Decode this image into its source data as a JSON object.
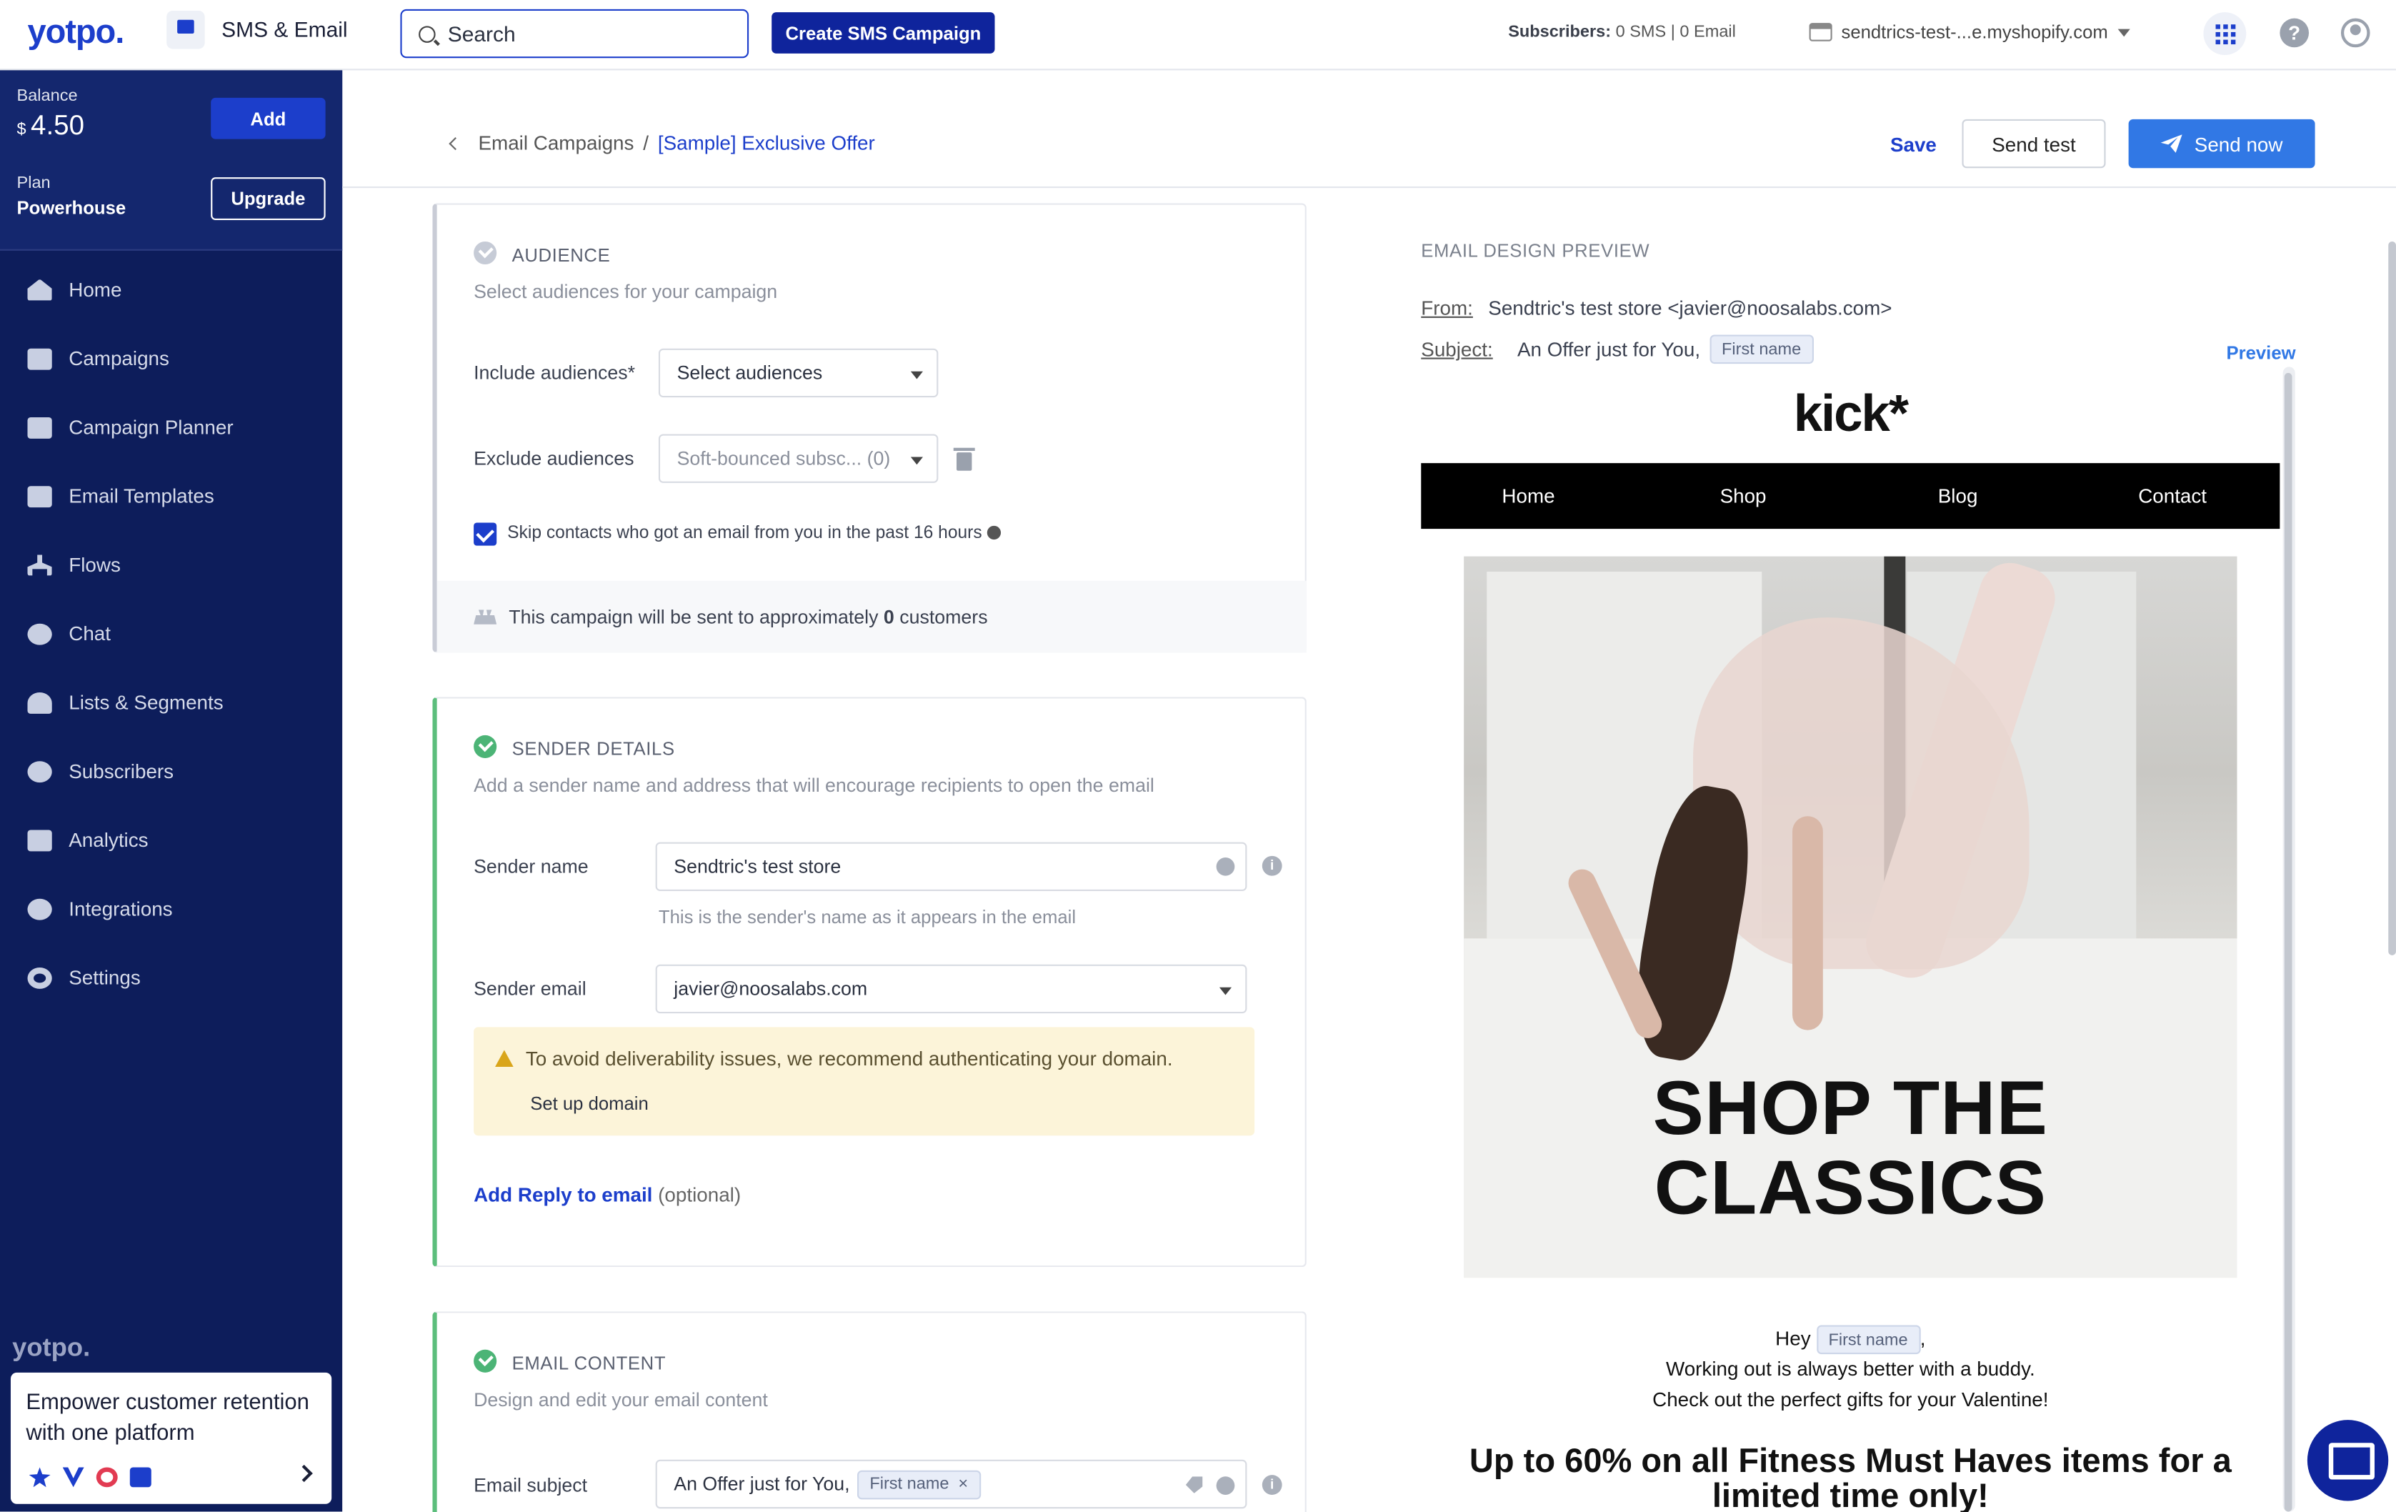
{
  "topbar": {
    "logo": "yotpo.",
    "app_name": "SMS & Email",
    "search_placeholder": "Search",
    "create_sms": "Create SMS Campaign",
    "subscribers_label": "Subscribers:",
    "subscribers_sms": "0 SMS",
    "subscribers_sep": "|",
    "subscribers_email": "0 Email",
    "store": "sendtrics-test-...e.myshopify.com"
  },
  "sidebar": {
    "balance_label": "Balance",
    "balance_currency": "$",
    "balance_value": "4.50",
    "add": "Add",
    "plan_label": "Plan",
    "plan_value": "Powerhouse",
    "upgrade": "Upgrade",
    "items": [
      {
        "label": "Home"
      },
      {
        "label": "Campaigns"
      },
      {
        "label": "Campaign Planner"
      },
      {
        "label": "Email Templates"
      },
      {
        "label": "Flows"
      },
      {
        "label": "Chat"
      },
      {
        "label": "Lists & Segments"
      },
      {
        "label": "Subscribers"
      },
      {
        "label": "Analytics"
      },
      {
        "label": "Integrations"
      },
      {
        "label": "Settings"
      }
    ],
    "footer_logo": "yotpo.",
    "promo_text": "Empower customer retention with one platform"
  },
  "header": {
    "crumb_parent": "Email Campaigns",
    "crumb_sep": "/",
    "crumb_current": "[Sample] Exclusive Offer",
    "save": "Save",
    "send_test": "Send test",
    "send_now": "Send now"
  },
  "audience": {
    "title": "AUDIENCE",
    "subtitle": "Select audiences for your campaign",
    "include_label": "Include audiences*",
    "include_placeholder": "Select audiences",
    "exclude_label": "Exclude audiences",
    "exclude_value": "Soft-bounced subsc... (0)",
    "skip_text": "Skip contacts who got an email from you in the past 16 hours",
    "estimate_pre": "This campaign will be sent to approximately",
    "estimate_count": "0",
    "estimate_post": "customers"
  },
  "sender": {
    "title": "SENDER DETAILS",
    "subtitle": "Add a sender name and address that will encourage recipients to open the email",
    "name_label": "Sender name",
    "name_value": "Sendtric's test store",
    "name_hint": "This is the sender's name as it appears in the email",
    "email_label": "Sender email",
    "email_value": "javier@noosalabs.com",
    "warning": "To avoid deliverability issues, we recommend authenticating your domain.",
    "setup_domain": "Set up domain",
    "reply_link": "Add Reply to email",
    "reply_optional": "(optional)"
  },
  "content": {
    "title": "EMAIL CONTENT",
    "subtitle": "Design and edit your email content",
    "subject_label": "Email subject",
    "subject_text": "An Offer just for You,",
    "subject_chip": "First name",
    "chip_remove": "×"
  },
  "preview": {
    "title": "EMAIL DESIGN PREVIEW",
    "from_label": "From:",
    "from_value": "Sendtric's test store <javier@noosalabs.com>",
    "subject_label": "Subject:",
    "subject_text": "An Offer just for You,",
    "subject_chip": "First name",
    "preview_link": "Preview",
    "brand": "kick*",
    "nav": [
      "Home",
      "Shop",
      "Blog",
      "Contact"
    ],
    "headline_1": "SHOP THE",
    "headline_2": "CLASSICS",
    "hey": "Hey",
    "hey_chip": "First name",
    "hey_comma": ",",
    "line_1": "Working out is always better with a buddy.",
    "line_2": "Check out the perfect gifts for your Valentine!",
    "promo": "Up to 60% on all Fitness Must Haves items for a limited time only!"
  },
  "colors": {
    "brand_blue": "#1c3ecb",
    "sidebar_bg": "#0d1d5b",
    "send_now": "#3178e5",
    "success": "#4cb476",
    "warning_bg": "#fcf4d9"
  }
}
